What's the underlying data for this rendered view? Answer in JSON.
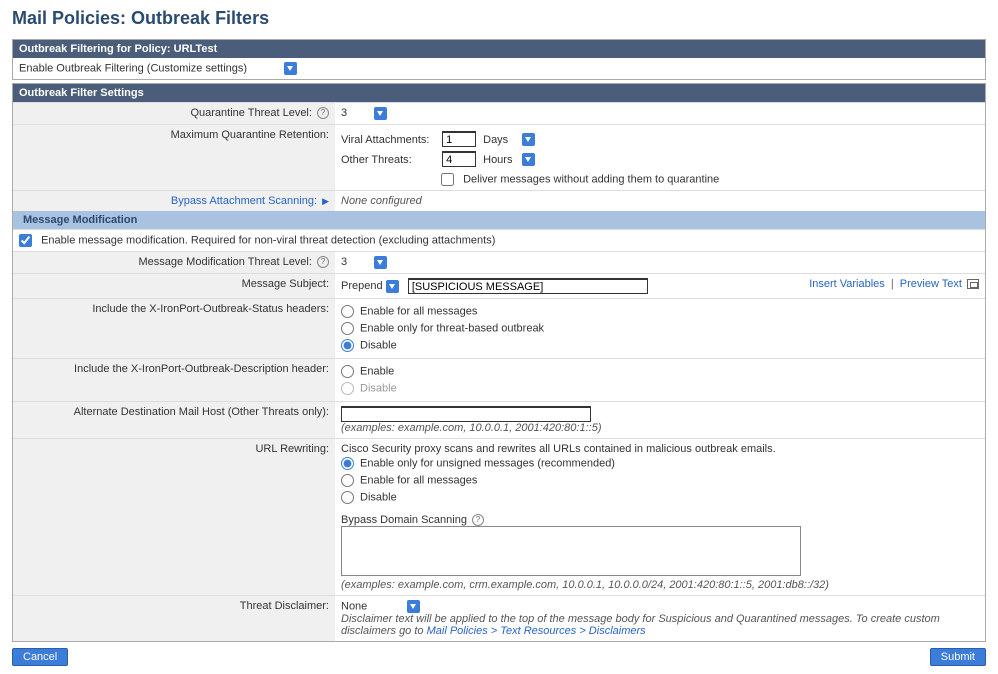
{
  "page_title": "Mail Policies: Outbreak Filters",
  "filtering_section": {
    "header": "Outbreak Filtering for Policy: URLTest",
    "enable_text": "Enable Outbreak Filtering (Customize settings)"
  },
  "settings_section": {
    "header": "Outbreak Filter Settings",
    "quarantine_label": "Quarantine Threat Level:",
    "quarantine_val": "3",
    "retention_label": "Maximum Quarantine Retention:",
    "viral_label": "Viral Attachments:",
    "viral_val": "1",
    "viral_unit": "Days",
    "other_label": "Other Threats:",
    "other_val": "4",
    "other_unit": "Hours",
    "deliver_label": "Deliver messages without adding them to quarantine",
    "bypass_label": "Bypass Attachment Scanning:",
    "bypass_val": "None configured"
  },
  "mod_section": {
    "subheader": "Message Modification",
    "enable_chk": "Enable message modification. Required for non-viral threat detection (excluding attachments)",
    "threat_label": "Message Modification Threat Level:",
    "threat_val": "3",
    "subject_label": "Message Subject:",
    "subject_mode": "Prepend",
    "subject_val": "[SUSPICIOUS MESSAGE]",
    "insert_link": "Insert Variables",
    "preview_link": "Preview Text",
    "status_hdr_label": "Include the X-IronPort-Outbreak-Status headers:",
    "status_opt1": "Enable for all messages",
    "status_opt2": "Enable only for threat-based outbreak",
    "status_opt3": "Disable",
    "desc_hdr_label": "Include the X-IronPort-Outbreak-Description header:",
    "desc_opt1": "Enable",
    "desc_opt2": "Disable",
    "alt_host_label": "Alternate Destination Mail Host (Other Threats only):",
    "alt_host_ex": "(examples: example.com, 10.0.0.1, 2001:420:80:1::5)",
    "url_label": "URL Rewriting:",
    "url_desc": "Cisco Security proxy scans and rewrites all URLs contained in malicious outbreak emails.",
    "url_opt1": "Enable only for unsigned messages (recommended)",
    "url_opt2": "Enable for all messages",
    "url_opt3": "Disable",
    "bypass_domain_label": "Bypass Domain Scanning",
    "bypass_domain_ex": "(examples: example.com, crm.example.com, 10.0.0.1, 10.0.0.0/24, 2001:420:80:1::5, 2001:db8::/32)",
    "disclaimer_label": "Threat Disclaimer:",
    "disclaimer_val": "None",
    "disclaimer_note_pre": "Disclaimer text will be applied to the top of the message body for Suspicious and Quarantined messages. To create custom disclaimers go to ",
    "disclaimer_link": "Mail Policies > Text Resources > Disclaimers"
  },
  "buttons": {
    "cancel": "Cancel",
    "submit": "Submit"
  }
}
